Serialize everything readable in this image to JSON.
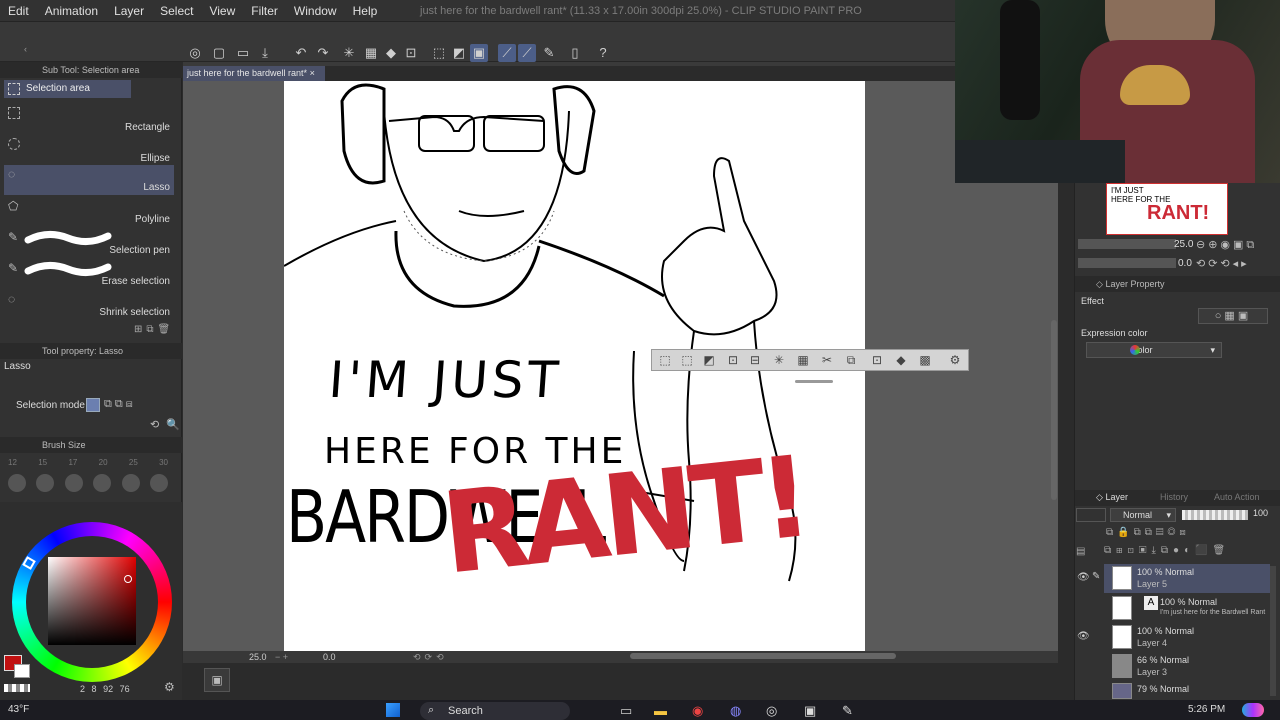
{
  "window": {
    "title": "just here for the bardwell rant* (11.33 x 17.00in 300dpi 25.0%) - CLIP STUDIO PAINT PRO"
  },
  "menu": [
    "Edit",
    "Animation",
    "Layer",
    "Select",
    "View",
    "Filter",
    "Window",
    "Help"
  ],
  "subtool": {
    "header": "Sub Tool: Selection area",
    "group": "Selection area",
    "items": [
      {
        "label": "Rectangle",
        "icon": "rectangle-select-icon"
      },
      {
        "label": "Ellipse",
        "icon": "ellipse-select-icon"
      },
      {
        "label": "Lasso",
        "icon": "lasso-icon"
      },
      {
        "label": "Polyline",
        "icon": "polyline-icon"
      },
      {
        "label": "Selection pen",
        "icon": "selection-pen-icon"
      },
      {
        "label": "Erase selection",
        "icon": "erase-selection-icon"
      },
      {
        "label": "Shrink selection",
        "icon": "shrink-selection-icon"
      }
    ]
  },
  "tool_property": {
    "header": "Tool property: Lasso",
    "tool_name": "Lasso",
    "selection_mode_label": "Selection mode"
  },
  "brush_size": {
    "header": "Brush Size",
    "sizes": [
      "12",
      "15",
      "17",
      "20",
      "25",
      "30"
    ]
  },
  "color_readout": [
    "2",
    "8",
    "92",
    "76"
  ],
  "canvas": {
    "tab": "just here for the bardwell rant*",
    "zoom": "25.0",
    "rotation": "0.0"
  },
  "artwork_text": {
    "line1": "I'M JUST",
    "line2": "HERE FOR THE",
    "line3": "BARDWELL",
    "rant": "RANT!"
  },
  "navigator": {
    "zoom": "25.0",
    "rotation": "0.0"
  },
  "layer_property": {
    "header": "Layer Property",
    "effect_label": "Effect",
    "expression_label": "Expression color",
    "expression_value": "Color"
  },
  "layer_panel": {
    "tabs": [
      "Layer",
      "History",
      "Auto Action"
    ],
    "blend_mode": "Normal",
    "opacity": "100",
    "layers": [
      {
        "mode": "100 % Normal",
        "name": "Layer 5"
      },
      {
        "mode": "100 % Normal",
        "name": "I'm just here for the Bardwell Rant"
      },
      {
        "mode": "100 % Normal",
        "name": "Layer 4"
      },
      {
        "mode": "66 % Normal",
        "name": "Layer 3"
      },
      {
        "mode": "79 % Normal",
        "name": ""
      }
    ]
  },
  "taskbar": {
    "weather": "43°F",
    "search_placeholder": "Search",
    "time": "5:26 PM"
  },
  "colors": {
    "accent": "#4a5068",
    "rant_red": "#cc2a36",
    "main_color": "#c01010"
  }
}
